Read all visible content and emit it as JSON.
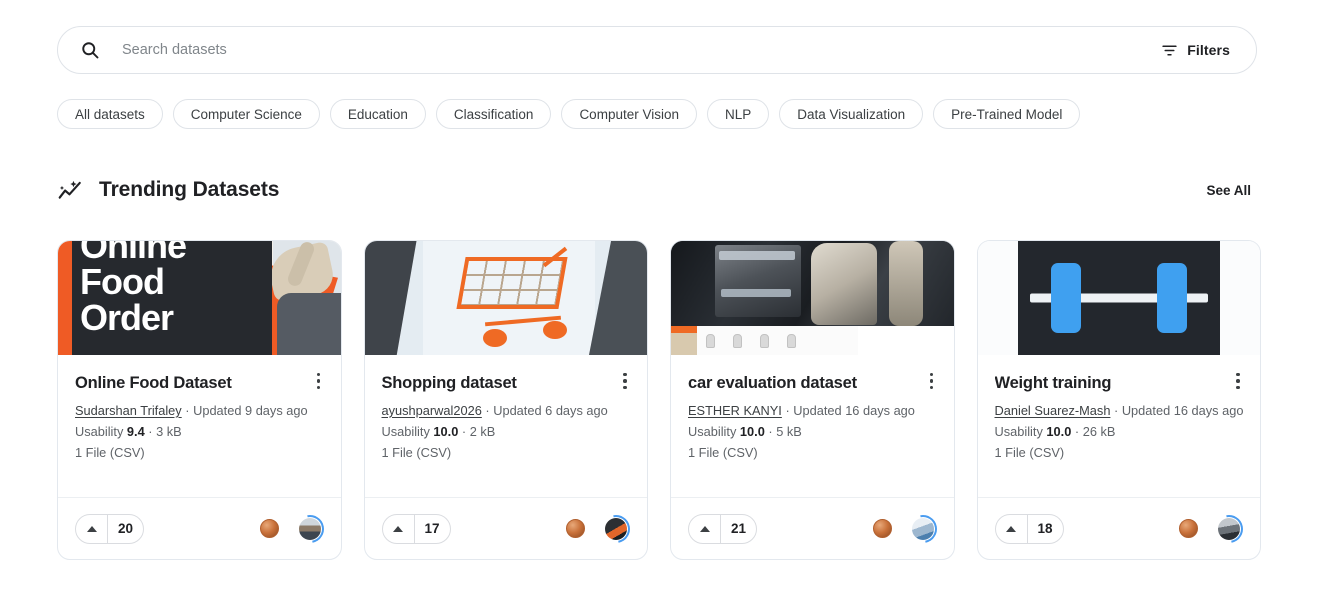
{
  "search": {
    "placeholder": "Search datasets",
    "value": "",
    "icon": "search-icon",
    "filters_label": "Filters",
    "filters_icon": "filter-icon"
  },
  "chips": [
    {
      "label": "All datasets"
    },
    {
      "label": "Computer Science"
    },
    {
      "label": "Education"
    },
    {
      "label": "Classification"
    },
    {
      "label": "Computer Vision"
    },
    {
      "label": "NLP"
    },
    {
      "label": "Data Visualization"
    },
    {
      "label": "Pre-Trained Model"
    }
  ],
  "section": {
    "icon": "trending-up-sparkle-icon",
    "title": "Trending Datasets",
    "see_all_label": "See All"
  },
  "cards": [
    {
      "title": "Online Food Dataset",
      "owner": "Sudarshan Trifaley",
      "updated": "· Updated 9 days ago",
      "usability_prefix": "Usability ",
      "usability": "9.4",
      "size": " · 3 kB",
      "files": "1 File (CSV)",
      "votes": "20",
      "thumb_alt": "Online Food Order",
      "thumb_text_1": "Online",
      "thumb_text_2": "Food",
      "thumb_text_3": "Order"
    },
    {
      "title": "Shopping dataset",
      "owner": "ayushparwal2026",
      "updated": "· Updated 6 days ago",
      "usability_prefix": "Usability ",
      "usability": "10.0",
      "size": " · 2 kB",
      "files": "1 File (CSV)",
      "votes": "17",
      "thumb_alt": "Shopping cart illustration"
    },
    {
      "title": "car evaluation dataset",
      "owner": "ESTHER KANYI",
      "updated": "· Updated 16 days ago",
      "usability_prefix": "Usability ",
      "usability": "10.0",
      "size": " · 5 kB",
      "files": "1 File (CSV)",
      "votes": "21",
      "thumb_alt": "Car interior photo"
    },
    {
      "title": "Weight training",
      "owner": "Daniel Suarez-Mash",
      "updated": "· Updated 16 days ago",
      "usability_prefix": "Usability ",
      "usability": "10.0",
      "size": " · 26 kB",
      "files": "1 File (CSV)",
      "votes": "18",
      "thumb_alt": "Blue dumbbell icon"
    }
  ],
  "colors": {
    "accent_orange": "#ef5b25",
    "accent_blue": "#3fa0f0",
    "text_primary": "#202124",
    "text_secondary": "#5f6368",
    "border": "#dfe3e8"
  }
}
